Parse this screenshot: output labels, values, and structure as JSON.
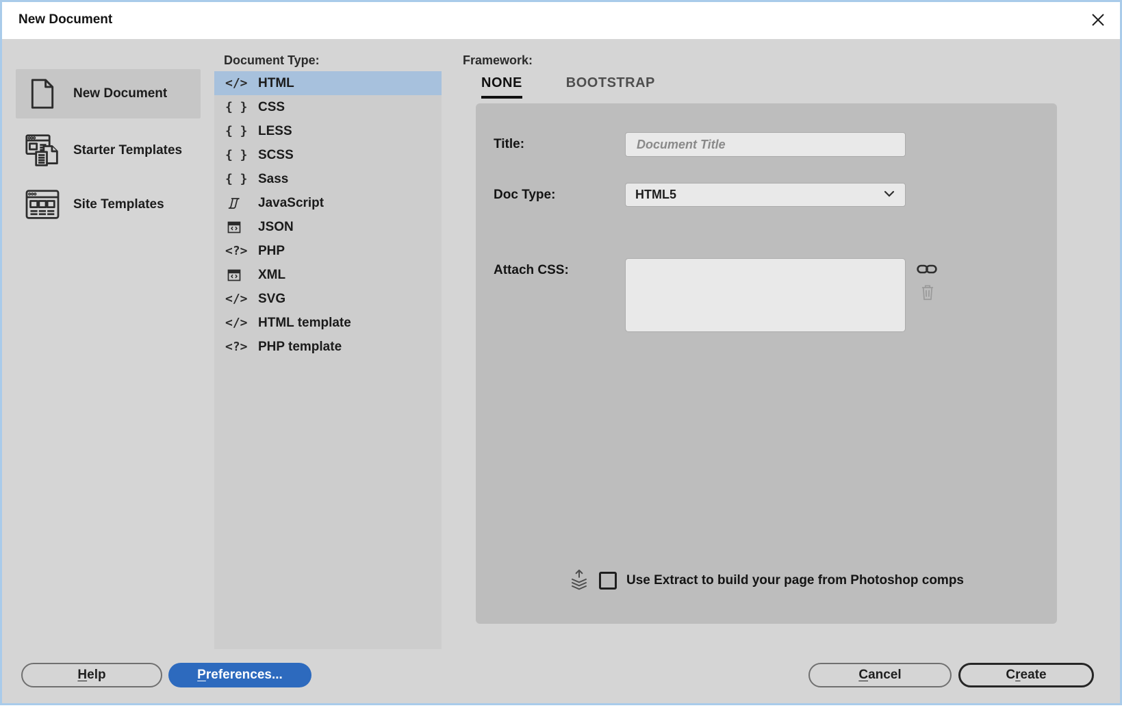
{
  "window": {
    "title": "New Document"
  },
  "colors": {
    "dialog_border": "#a9cbea",
    "dialog_background": "#d5d5d5",
    "list_selection_blue": "#a7c1dd",
    "accent_button_blue": "#2d6abe",
    "framework_panel_gray": "#bdbdbd"
  },
  "sidebar": {
    "items": [
      {
        "label": "New Document",
        "icon": "blank-document-icon",
        "selected": true
      },
      {
        "label": "Starter Templates",
        "icon": "starter-templates-icon",
        "selected": false
      },
      {
        "label": "Site Templates",
        "icon": "site-templates-icon",
        "selected": false
      }
    ]
  },
  "document_type": {
    "label": "Document Type:",
    "items": [
      {
        "label": "HTML",
        "glyph": "</>",
        "icon": "code-icon",
        "selected": true
      },
      {
        "label": "CSS",
        "glyph": "{ }",
        "icon": "braces-icon",
        "selected": false
      },
      {
        "label": "LESS",
        "glyph": "{ }",
        "icon": "braces-icon",
        "selected": false
      },
      {
        "label": "SCSS",
        "glyph": "{ }",
        "icon": "braces-icon",
        "selected": false
      },
      {
        "label": "Sass",
        "glyph": "{ }",
        "icon": "braces-icon",
        "selected": false
      },
      {
        "label": "JavaScript",
        "glyph": "",
        "icon": "scroll-icon",
        "selected": false
      },
      {
        "label": "JSON",
        "glyph": "",
        "icon": "window-code-icon",
        "selected": false
      },
      {
        "label": "PHP",
        "glyph": "<?>",
        "icon": "php-code-icon",
        "selected": false
      },
      {
        "label": "XML",
        "glyph": "",
        "icon": "window-code-icon",
        "selected": false
      },
      {
        "label": "SVG",
        "glyph": "</>",
        "icon": "code-icon",
        "selected": false
      },
      {
        "label": "HTML template",
        "glyph": "</>",
        "icon": "code-icon",
        "selected": false
      },
      {
        "label": "PHP template",
        "glyph": "<?>",
        "icon": "php-code-icon",
        "selected": false
      }
    ]
  },
  "framework": {
    "label": "Framework:",
    "tabs": [
      {
        "label": "NONE",
        "active": true
      },
      {
        "label": "BOOTSTRAP",
        "active": false
      }
    ],
    "form": {
      "title_label": "Title:",
      "title_value": "",
      "title_placeholder": "Document Title",
      "doc_type_label": "Doc Type:",
      "doc_type_value": "HTML5",
      "attach_css_label": "Attach CSS:",
      "attach_css_value": ""
    },
    "extract": {
      "label": "Use Extract to build your page from Photoshop comps",
      "checked": false
    }
  },
  "footer": {
    "help": {
      "pre": "",
      "key": "H",
      "post": "elp"
    },
    "preferences": {
      "pre": "",
      "key": "P",
      "post": "references..."
    },
    "cancel": {
      "pre": "",
      "key": "C",
      "post": "ancel"
    },
    "create": {
      "pre": "C",
      "key": "r",
      "post": "eate"
    }
  }
}
